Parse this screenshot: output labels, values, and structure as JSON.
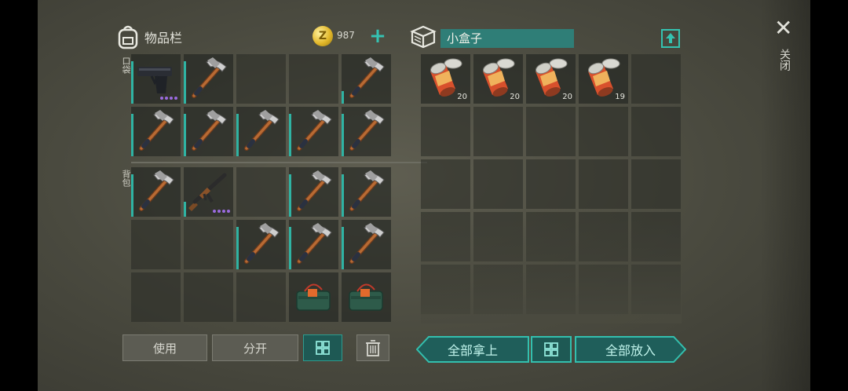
{
  "inventory": {
    "title": "物品栏",
    "coins": "987",
    "pocket_label": "口袋",
    "backpack_label": "背包",
    "pocket_slots": [
      {
        "item": "pistol-icon",
        "bar": 0.85,
        "rarity_dots": 4
      },
      {
        "item": "pickaxe-icon",
        "bar": 0.85
      },
      {
        "item": ""
      },
      {
        "item": ""
      },
      {
        "item": "pickaxe-icon",
        "bar": 0.25
      },
      {
        "item": "pickaxe-icon",
        "bar": 0.85
      },
      {
        "item": "pickaxe-icon",
        "bar": 0.85
      },
      {
        "item": "pickaxe-icon",
        "bar": 0.85
      },
      {
        "item": "pickaxe-icon",
        "bar": 0.85
      },
      {
        "item": "pickaxe-icon",
        "bar": 0.85
      }
    ],
    "backpack_slots": [
      {
        "item": "pickaxe-icon",
        "bar": 0.85
      },
      {
        "item": "rifle-icon",
        "bar": 0.3,
        "rarity_dots": 4
      },
      {
        "item": ""
      },
      {
        "item": "pickaxe-icon",
        "bar": 0.85
      },
      {
        "item": "pickaxe-icon",
        "bar": 0.85
      },
      {
        "item": ""
      },
      {
        "item": ""
      },
      {
        "item": "pickaxe-icon",
        "bar": 0.85
      },
      {
        "item": "pickaxe-icon",
        "bar": 0.85
      },
      {
        "item": "pickaxe-icon",
        "bar": 0.85
      },
      {
        "item": ""
      },
      {
        "item": ""
      },
      {
        "item": ""
      },
      {
        "item": "explosive-pack-icon"
      },
      {
        "item": "explosive-pack-icon"
      }
    ]
  },
  "container": {
    "name": "小盒子",
    "slots": [
      {
        "item": "canned-food-icon",
        "qty": "20"
      },
      {
        "item": "canned-food-icon",
        "qty": "20"
      },
      {
        "item": "canned-food-icon",
        "qty": "20"
      },
      {
        "item": "canned-food-icon",
        "qty": "19"
      }
    ]
  },
  "buttons": {
    "use": "使用",
    "split": "分开",
    "take_all": "全部拿上",
    "put_all": "全部放入"
  },
  "close_label": "关闭",
  "colors": {
    "accent": "#33bfae",
    "bar": "#2fb3a3",
    "rarity": "#9b6be0"
  }
}
